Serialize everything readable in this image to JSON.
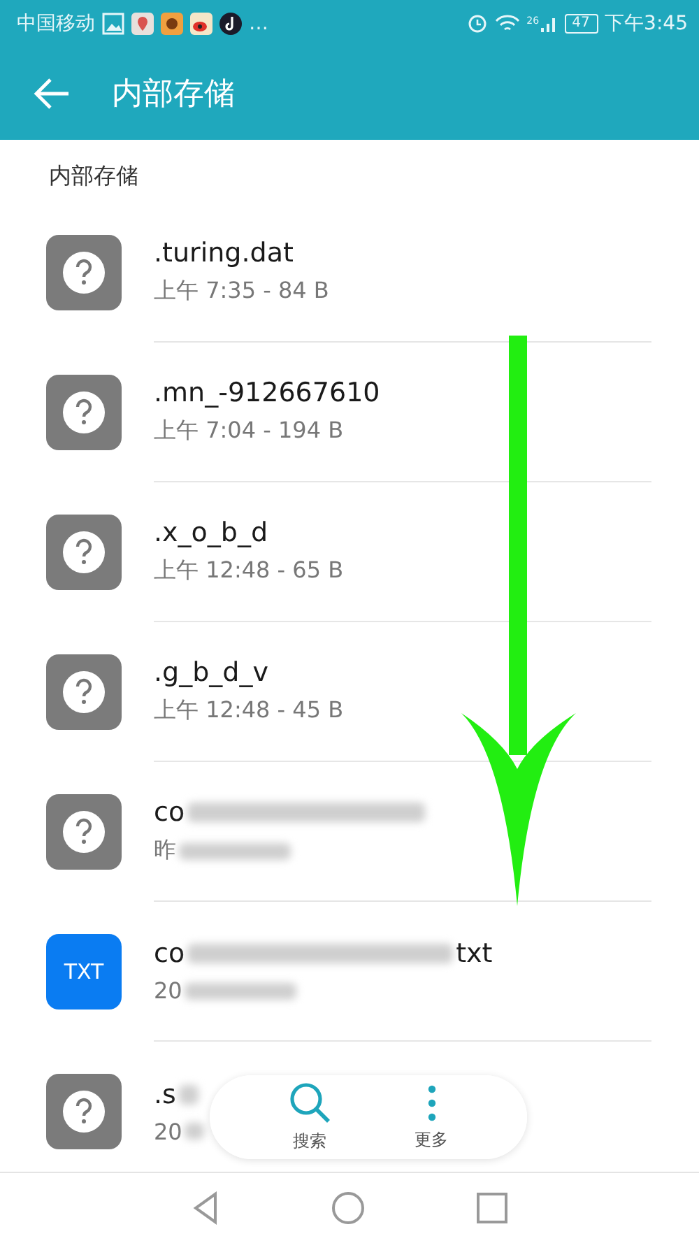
{
  "status_bar": {
    "carrier": "中国移动",
    "more": "…",
    "signal_label": "26",
    "battery": "47",
    "time": "下午3:45"
  },
  "header": {
    "title": "内部存储"
  },
  "section": {
    "label": "内部存储"
  },
  "files": [
    {
      "kind": "unknown",
      "name": ".turing.dat",
      "meta": "上午 7:35  - 84 B"
    },
    {
      "kind": "unknown",
      "name": ".mn_-912667610",
      "meta": "上午 7:04  - 194 B"
    },
    {
      "kind": "unknown",
      "name": ".x_o_b_d",
      "meta": "上午 12:48  - 65 B"
    },
    {
      "kind": "unknown",
      "name": ".g_b_d_v",
      "meta": "上午 12:48  - 45 B"
    },
    {
      "kind": "unknown",
      "name": "co",
      "meta": "昨",
      "blurred": true
    },
    {
      "kind": "text",
      "icon_label": "TXT",
      "name": "co",
      "name_end": "txt",
      "meta": "20",
      "blurred": true
    },
    {
      "kind": "unknown",
      "name": ".s",
      "meta": "20",
      "blurred": true
    }
  ],
  "floating_bar": [
    {
      "kind": "search",
      "label": "搜索"
    },
    {
      "kind": "more",
      "label": "更多"
    }
  ],
  "annotation": {
    "kind": "arrow"
  }
}
